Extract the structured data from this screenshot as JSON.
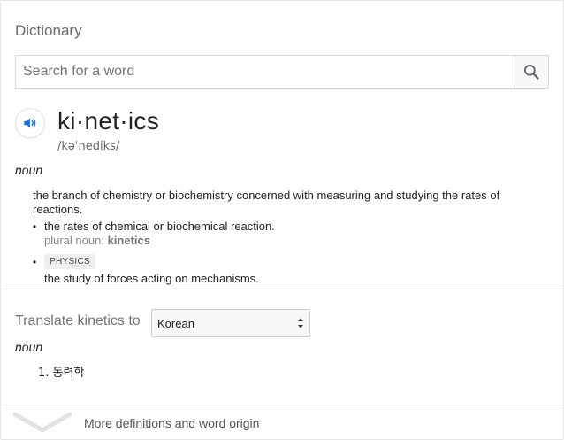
{
  "header": {
    "title": "Dictionary"
  },
  "search": {
    "placeholder": "Search for a word",
    "value": ""
  },
  "entry": {
    "headword": "ki·net·ics",
    "phonetic": "/kəˈnediks/",
    "part_of_speech": "noun",
    "main_definition": "the branch of chemistry or biochemistry concerned with measuring and studying the rates of reactions.",
    "senses": [
      {
        "text": "the rates of chemical or biochemical reaction.",
        "note_label": "plural noun:",
        "note_value": "kinetics"
      },
      {
        "tag": "PHYSICS",
        "text": "the study of forces acting on mechanisms."
      }
    ]
  },
  "translate": {
    "label": "Translate kinetics to",
    "language": "Korean",
    "part_of_speech": "noun",
    "results": [
      {
        "number": "1.",
        "text": "동력학"
      }
    ]
  },
  "footer": {
    "more_label": "More definitions and word origin"
  },
  "icons": {
    "search": "search-icon",
    "speaker": "speaker-icon",
    "select": "select-arrows-icon",
    "expand": "chevron-down-icon"
  },
  "colors": {
    "speaker_blue": "#1a73e8",
    "muted_text": "#878787",
    "border": "#d9d9d9"
  }
}
